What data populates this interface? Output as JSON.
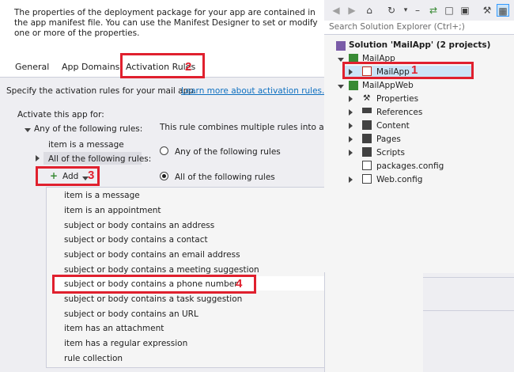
{
  "designer": {
    "description": "The properties of the deployment package for your app are contained in the app manifest file. You can use the Manifest Designer to set or modify one or more of the properties.",
    "tabs": [
      {
        "label": "General"
      },
      {
        "label": "App Domains"
      },
      {
        "label": "Activation Rules"
      }
    ],
    "specify_text": "Specify the activation rules for your mail app.",
    "learn_more_link": "Learn more about activation rules.",
    "activate_label": "Activate this app for:",
    "tree": {
      "root": "Any of the following rules:",
      "child1": "item is a message",
      "child2": "All of the following rules:"
    },
    "right_desc": "This rule combines multiple rules into a single r",
    "radio_any": "Any of the following rules",
    "radio_all": "All of the following rules",
    "add_label": "Add",
    "add_plus": "+",
    "menu_items": [
      "item is a message",
      "item is an appointment",
      "subject or body contains an address",
      "subject or body contains a contact",
      "subject or body contains an email address",
      "subject or body contains a meeting suggestion",
      "subject or body contains a phone number",
      "subject or body contains a task suggestion",
      "subject or body contains an URL",
      "item has an attachment",
      "item has a regular expression",
      "rule collection"
    ]
  },
  "solution_explorer": {
    "search_placeholder": "Search Solution Explorer (Ctrl+;)",
    "solution_label": "Solution 'MailApp' (2 projects)",
    "items": [
      "MailApp",
      "MailApp",
      "MailAppWeb",
      "Properties",
      "References",
      "Content",
      "Pages",
      "Scripts",
      "packages.config",
      "Web.config"
    ]
  },
  "annotations": [
    "1",
    "2",
    "3",
    "4"
  ],
  "colors": {
    "annotation_red": "#e0202e",
    "link_blue": "#0e70c0",
    "panel_bg": "#eeeef2"
  }
}
